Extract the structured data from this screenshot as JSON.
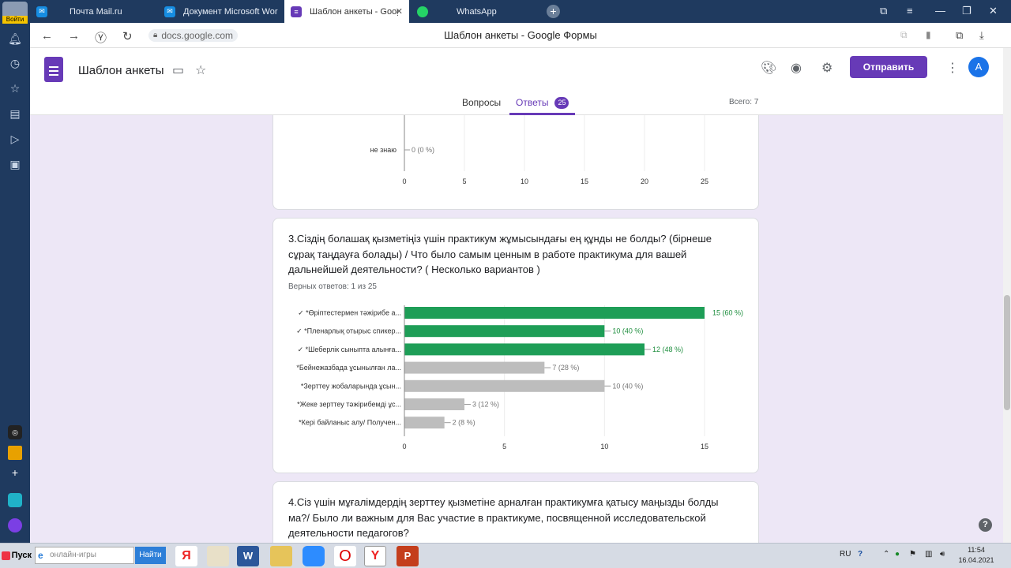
{
  "browser": {
    "tabs": [
      {
        "label": "Почта Mail.ru",
        "icon": "mail-icon"
      },
      {
        "label": "Документ Microsoft Word...",
        "icon": "word-icon"
      },
      {
        "label": "Шаблон анкеты - Goog",
        "icon": "forms-icon",
        "active": true
      },
      {
        "label": "WhatsApp",
        "icon": "whatsapp-icon"
      }
    ],
    "login_label": "Войти",
    "url": "docs.google.com",
    "page_title": "Шаблон анкеты - Google Формы"
  },
  "form": {
    "title": "Шаблон анкеты",
    "send_label": "Отправить",
    "avatar_letter": "A",
    "tab_questions": "Вопросы",
    "tab_answers": "Ответы",
    "answers_count": "25",
    "total": "Всего: 7"
  },
  "chart_top": {
    "type": "bar",
    "visible_category": "не знаю",
    "visible_label": "0 (0 %)",
    "ticks": [
      "0",
      "5",
      "10",
      "15",
      "20",
      "25"
    ],
    "xlim": [
      0,
      25
    ]
  },
  "question3": {
    "title": "3.Сіздің болашақ қызметіңіз үшін практикум жұмысындағы ең құнды не болды? (бірнеше сұрақ таңдауға болады) / Что было самым ценным в работе практикума для вашей дальнейшей деятельности? ( Несколько вариантов )",
    "correct_text": "Верных ответов: 1 из 25"
  },
  "chart_data": {
    "type": "bar",
    "orientation": "horizontal",
    "categories": [
      "✓ *Өріптестермен тәжірибе а...",
      "✓ *Пленарлық отырыс спикер...",
      "✓ *Шеберлік сыныпта алынға...",
      "*Бейнежазбада ұсынылған ла...",
      "*Зерттеу жобаларында ұсын...",
      "*Жеке зерттеу тәжірибемді ұс...",
      "*Кері байланыс алу/ Получен..."
    ],
    "values": [
      15,
      10,
      12,
      7,
      10,
      3,
      2
    ],
    "labels": [
      "15 (60 %)",
      "10 (40 %)",
      "12 (48 %)",
      "7 (28 %)",
      "10 (40 %)",
      "3 (12 %)",
      "2 (8 %)"
    ],
    "correct": [
      true,
      true,
      true,
      false,
      false,
      false,
      false
    ],
    "colors": {
      "correct": "#1e9e57",
      "incorrect": "#bdbdbd",
      "correct_label": "#1e8e3e",
      "incorrect_label": "#757575"
    },
    "ticks": [
      "0",
      "5",
      "10",
      "15"
    ],
    "xlim": [
      0,
      15
    ]
  },
  "question4": {
    "title": "4.Сіз үшін мұғалімдердің зерттеу қызметіне арналған практикумға қатысу маңызды болды ма?/ Было ли важным для Вас участие в практикуме, посвященной исследовательской деятельности педагогов?"
  },
  "taskbar": {
    "start_label": "Пуск",
    "search_placeholder": "онлайн-игры",
    "find_label": "Найти",
    "lang": "RU",
    "time": "11:54",
    "date": "16.04.2021"
  }
}
